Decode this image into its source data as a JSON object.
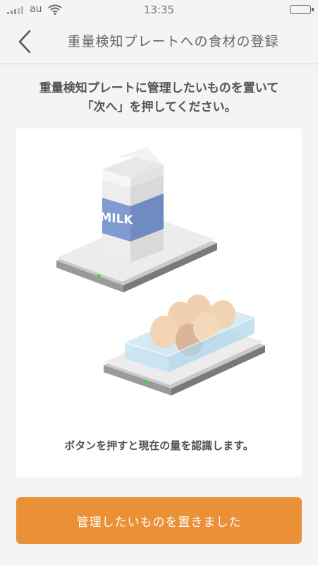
{
  "status_bar": {
    "carrier": "au",
    "time": "13:35"
  },
  "nav": {
    "title": "重量検知プレートへの食材の登録",
    "back_icon": "chevron-left-icon"
  },
  "instruction": {
    "line1": "重量検知プレートに管理したいものを置いて",
    "line2": "「次へ」を押してください。"
  },
  "illustration": {
    "milk_label": "MILK",
    "caption": "ボタンを押すと現在の量を認識します。"
  },
  "submit_label": "管理したいものを置きました",
  "colors": {
    "accent": "#ea9037",
    "milk_carton": "#7f9bd0",
    "indicator": "#4ccd57",
    "background": "#f4f4f4"
  }
}
